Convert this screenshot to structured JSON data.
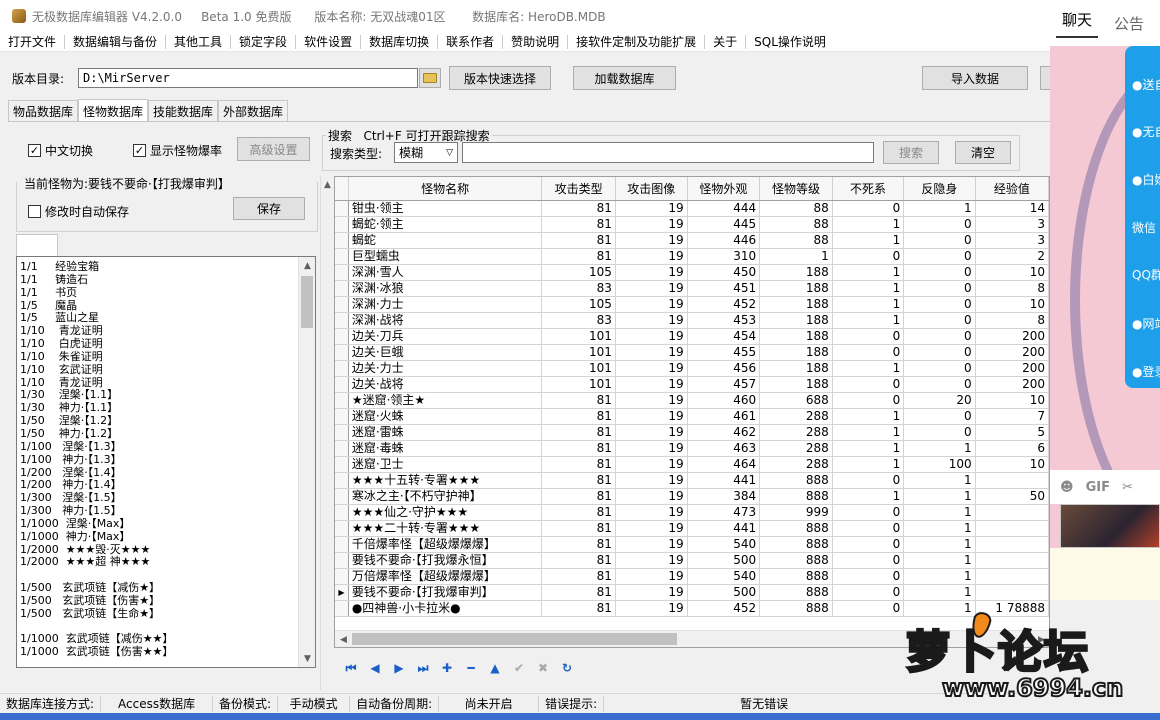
{
  "window": {
    "title": "无极数据库编辑器 V4.2.0.0     Beta 1.0 免费版      版本名称: 无双战魂01区       数据库名: HeroDB.MDB"
  },
  "menu": [
    "打开文件",
    "数据编辑与备份",
    "其他工具",
    "锁定字段",
    "软件设置",
    "数据库切换",
    "联系作者",
    "赞助说明",
    "接软件定制及功能扩展",
    "关于",
    "SQL操作说明"
  ],
  "toolbar": {
    "dir_label": "版本目录:",
    "dir_value": "D:\\MirServer",
    "quick_select": "版本快速选择",
    "load_db": "加载数据库",
    "import_data": "导入数据"
  },
  "tabs": [
    "物品数据库",
    "怪物数据库",
    "技能数据库",
    "外部数据库"
  ],
  "active_tab": 1,
  "options": {
    "chinese_switch": "中文切换",
    "show_drop": "显示怪物爆率",
    "advanced": "高级设置",
    "auto_save": "修改时自动保存",
    "save": "保存",
    "current_monster": "当前怪物为:要钱不要命·【打我爆审判】"
  },
  "search": {
    "legend": "搜索   Ctrl+F 可打开跟踪搜索",
    "type_label": "搜索类型:",
    "type_value": "模糊",
    "search_btn": "搜索",
    "clear_btn": "清空"
  },
  "drop_list": [
    "1/1     经验宝箱",
    "1/1     铸造石",
    "1/1     书页",
    "1/5     魔晶",
    "1/5     蓝山之星",
    "1/10    青龙证明",
    "1/10    白虎证明",
    "1/10    朱雀证明",
    "1/10    玄武证明",
    "1/10    青龙证明",
    "1/30    涅槃·【1.1】",
    "1/30    神力·【1.1】",
    "1/50    涅槃·【1.2】",
    "1/50    神力·【1.2】",
    "1/100   涅槃·【1.3】",
    "1/100   神力·【1.3】",
    "1/200   涅槃·【1.4】",
    "1/200   神力·【1.4】",
    "1/300   涅槃·【1.5】",
    "1/300   神力·【1.5】",
    "1/1000  涅槃·【Max】",
    "1/1000  神力·【Max】",
    "1/2000  ★★★毁·灭★★★",
    "1/2000  ★★★超 神★★★",
    "",
    "1/500   玄武项链【减伤★】",
    "1/500   玄武项链【伤害★】",
    "1/500   玄武项链【生命★】",
    "",
    "1/1000  玄武项链【减伤★★】",
    "1/1000  玄武项链【伤害★★】"
  ],
  "grid": {
    "columns": [
      "怪物名称",
      "攻击类型",
      "攻击图像",
      "怪物外观",
      "怪物等级",
      "不死系",
      "反隐身",
      "经验值"
    ],
    "current_row": 24,
    "rows": [
      [
        "钳虫·领主",
        "81",
        "19",
        "444",
        "88",
        "0",
        "1",
        "14"
      ],
      [
        "蝎蛇·领主",
        "81",
        "19",
        "445",
        "88",
        "1",
        "0",
        "3"
      ],
      [
        "蝎蛇",
        "81",
        "19",
        "446",
        "88",
        "1",
        "0",
        "3"
      ],
      [
        "巨型蠕虫",
        "81",
        "19",
        "310",
        "1",
        "0",
        "0",
        "2"
      ],
      [
        "深渊·雪人",
        "105",
        "19",
        "450",
        "188",
        "1",
        "0",
        "10"
      ],
      [
        "深渊·冰狼",
        "83",
        "19",
        "451",
        "188",
        "1",
        "0",
        "8"
      ],
      [
        "深渊·力士",
        "105",
        "19",
        "452",
        "188",
        "1",
        "0",
        "10"
      ],
      [
        "深渊·战将",
        "83",
        "19",
        "453",
        "188",
        "1",
        "0",
        "8"
      ],
      [
        "边关·刀兵",
        "101",
        "19",
        "454",
        "188",
        "0",
        "0",
        "200"
      ],
      [
        "边关·巨蛾",
        "101",
        "19",
        "455",
        "188",
        "0",
        "0",
        "200"
      ],
      [
        "边关·力士",
        "101",
        "19",
        "456",
        "188",
        "1",
        "0",
        "200"
      ],
      [
        "边关·战将",
        "101",
        "19",
        "457",
        "188",
        "0",
        "0",
        "200"
      ],
      [
        "★迷窟·领主★",
        "81",
        "19",
        "460",
        "688",
        "0",
        "20",
        "10"
      ],
      [
        "迷窟·火蛛",
        "81",
        "19",
        "461",
        "288",
        "1",
        "0",
        "7"
      ],
      [
        "迷窟·雷蛛",
        "81",
        "19",
        "462",
        "288",
        "1",
        "0",
        "5"
      ],
      [
        "迷窟·毒蛛",
        "81",
        "19",
        "463",
        "288",
        "1",
        "1",
        "6"
      ],
      [
        "迷窟·卫士",
        "81",
        "19",
        "464",
        "288",
        "1",
        "100",
        "10"
      ],
      [
        "★★★十五转·专署★★★",
        "81",
        "19",
        "441",
        "888",
        "0",
        "1",
        ""
      ],
      [
        "寒冰之主·【不朽守护神】",
        "81",
        "19",
        "384",
        "888",
        "1",
        "1",
        "50"
      ],
      [
        "★★★仙之·守护★★★",
        "81",
        "19",
        "473",
        "999",
        "0",
        "1",
        ""
      ],
      [
        "★★★二十转·专署★★★",
        "81",
        "19",
        "441",
        "888",
        "0",
        "1",
        ""
      ],
      [
        "千倍爆率怪【超级爆爆爆】",
        "81",
        "19",
        "540",
        "888",
        "0",
        "1",
        ""
      ],
      [
        "要钱不要命·【打我爆永恒】",
        "81",
        "19",
        "500",
        "888",
        "0",
        "1",
        ""
      ],
      [
        "万倍爆率怪【超级爆爆爆】",
        "81",
        "19",
        "540",
        "888",
        "0",
        "1",
        ""
      ],
      [
        "要钱不要命·【打我爆审判】",
        "81",
        "19",
        "500",
        "888",
        "0",
        "1",
        ""
      ],
      [
        "●四神兽·小卡拉米●",
        "81",
        "19",
        "452",
        "888",
        "0",
        "1",
        "1    78888"
      ]
    ]
  },
  "statusbar": {
    "conn_label": "数据库连接方式:",
    "conn_value": "Access数据库",
    "backup_label": "备份模式:",
    "backup_value": "手动模式",
    "auto_label": "自动备份周期:",
    "auto_value": "尚未开启",
    "err_label": "错误提示:",
    "err_value": "暂无错误"
  },
  "chat": {
    "tab_chat": "聊天",
    "tab_notice": "公告",
    "menu": [
      "●送自",
      "●无自",
      "●白嫖",
      "微信",
      "QQ群",
      "●网站",
      "●登录"
    ],
    "gif": "GIF"
  },
  "watermark": {
    "title": "萝卜论坛",
    "url": "www.6994.cn"
  },
  "colors": {
    "accent_blue": "#1e9fea",
    "nav_blue": "#1a5fc7"
  }
}
